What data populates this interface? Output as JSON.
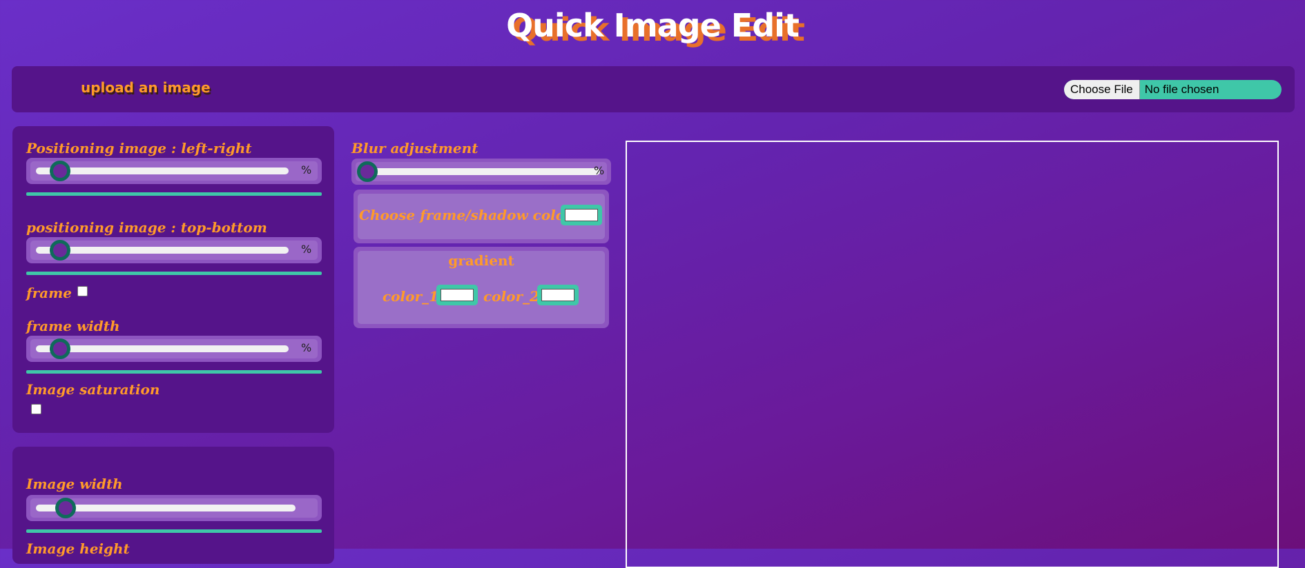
{
  "app": {
    "title": "Quick Image Edit"
  },
  "upload": {
    "label": "upload an image",
    "button_label": "Choose File",
    "status": "No file chosen"
  },
  "panel_position": {
    "left_right": {
      "label": "Positioning image : left-right",
      "unit": "%",
      "value_fraction": 0.09
    },
    "top_bottom": {
      "label": "positioning image : top-bottom",
      "unit": "%",
      "value_fraction": 0.09
    },
    "frame": {
      "label": "frame",
      "checked": false
    },
    "frame_width": {
      "label": "frame width",
      "unit": "%",
      "value_fraction": 0.09
    },
    "saturation": {
      "label": "Image saturation",
      "checked": false
    }
  },
  "panel_size": {
    "width": {
      "label": "Image width",
      "value_fraction": 0.1
    },
    "height": {
      "label": "Image height"
    }
  },
  "effects": {
    "blur": {
      "label": "Blur adjustment",
      "unit": "%",
      "value_fraction": 0.0
    },
    "frame_color": {
      "label": "Choose frame/shadow color",
      "value": "#ffffff"
    },
    "gradient": {
      "title": "gradient",
      "color_1_label": "color_1",
      "color_2_label": "color_2",
      "color_1": "#ffffff",
      "color_2": "#ffffff"
    }
  },
  "colors": {
    "accent_orange": "#ff9a2a",
    "accent_teal": "#3fc7a8",
    "panel_bg": "#55148a"
  }
}
